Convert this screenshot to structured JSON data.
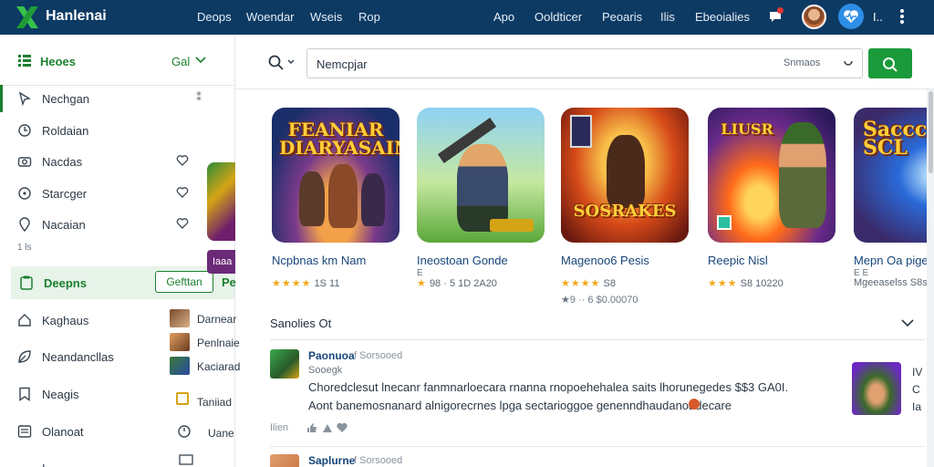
{
  "topbar": {
    "brand": "Hanlenai",
    "nav_left": [
      "Deops",
      "Woendar",
      "Wseis",
      "Rop"
    ],
    "nav_right": [
      "Apo",
      "Ooldticer",
      "Peoaris",
      "Ilis",
      "Ebeoialies"
    ],
    "more_label": "I..",
    "colors": {
      "bar": "#0d3a63",
      "accent": "#2e8ee6"
    }
  },
  "sidebar": {
    "header_title": "Heoes",
    "header_filter": "Gal",
    "items": [
      {
        "label": "Nechgan",
        "icon": "navigation-icon"
      },
      {
        "label": "Roldaian",
        "icon": "clock-icon"
      },
      {
        "label": "Nacdas",
        "icon": "camera-icon"
      },
      {
        "label": "Starcger",
        "icon": "compass-icon"
      },
      {
        "label": "Nacaian",
        "icon": "map-pin-icon"
      }
    ],
    "small_label": "1 ls",
    "active": {
      "label": "Deepns",
      "button": "Gefttan",
      "more": "Pe"
    },
    "items2": [
      {
        "label": "Kaghaus",
        "icon": "home-icon"
      },
      {
        "label": "Neandancllas",
        "icon": "leaf-icon"
      },
      {
        "label": "Neagis",
        "icon": "bookmark-icon"
      },
      {
        "label": "Olanoat",
        "icon": "list-icon"
      },
      {
        "label": "I",
        "icon": "menu-icon"
      }
    ],
    "subpanel": [
      "Darnear",
      "Penlnaie",
      "Kaciarad",
      "Taniiad",
      "Uane"
    ],
    "peek_label": "Iaaa"
  },
  "search": {
    "value": "Nemcpjar",
    "option": "Snmaos",
    "colors": {
      "button": "#1a9a3a"
    }
  },
  "games": [
    {
      "art_title": "FEANIAR DIARYASAIN",
      "name": "Ncpbnas km Nam",
      "stars": "★★★★",
      "score": "1S 11",
      "extra": ""
    },
    {
      "art_title": "",
      "name": "Ineostoan Gonde",
      "sub": "E",
      "stars": "★",
      "score": "98  ·  5 1D 2A20",
      "extra": ""
    },
    {
      "art_title": "SOSRAKES",
      "name": "Magenoo6 Pesis",
      "stars": "★★★★",
      "score": "S8",
      "extra": "★9 ·· 6 $0.00070"
    },
    {
      "art_title": "LIUSR",
      "name": "Reepic Nisl",
      "stars": "★★★",
      "score": "S8 10220",
      "extra": ""
    },
    {
      "art_title": "Sacccer SCL",
      "name": "Mepn Oa pige",
      "sub": "E E",
      "stars": "",
      "score": "Mgeeaselss  S8s",
      "extra": ""
    }
  ],
  "section": {
    "title": "Sanolies Ot"
  },
  "posts": [
    {
      "name": "Paonuoa",
      "meta": "f Sorsooed",
      "date": "Sooegk",
      "body1": "Choredclesut lnecanr fanmnarloecara rnanna rnopoehehalea saits lhorunegedes $$3 GA0I.",
      "body2": "Aont banemosnanard alnigorecrnes lpga  sectarioggoe genenndhaudanoadecare",
      "foot": "Ilien",
      "side": [
        "IV",
        "C",
        "Ia"
      ]
    },
    {
      "name": "Saplurne",
      "meta": "f Sorsooed"
    }
  ]
}
